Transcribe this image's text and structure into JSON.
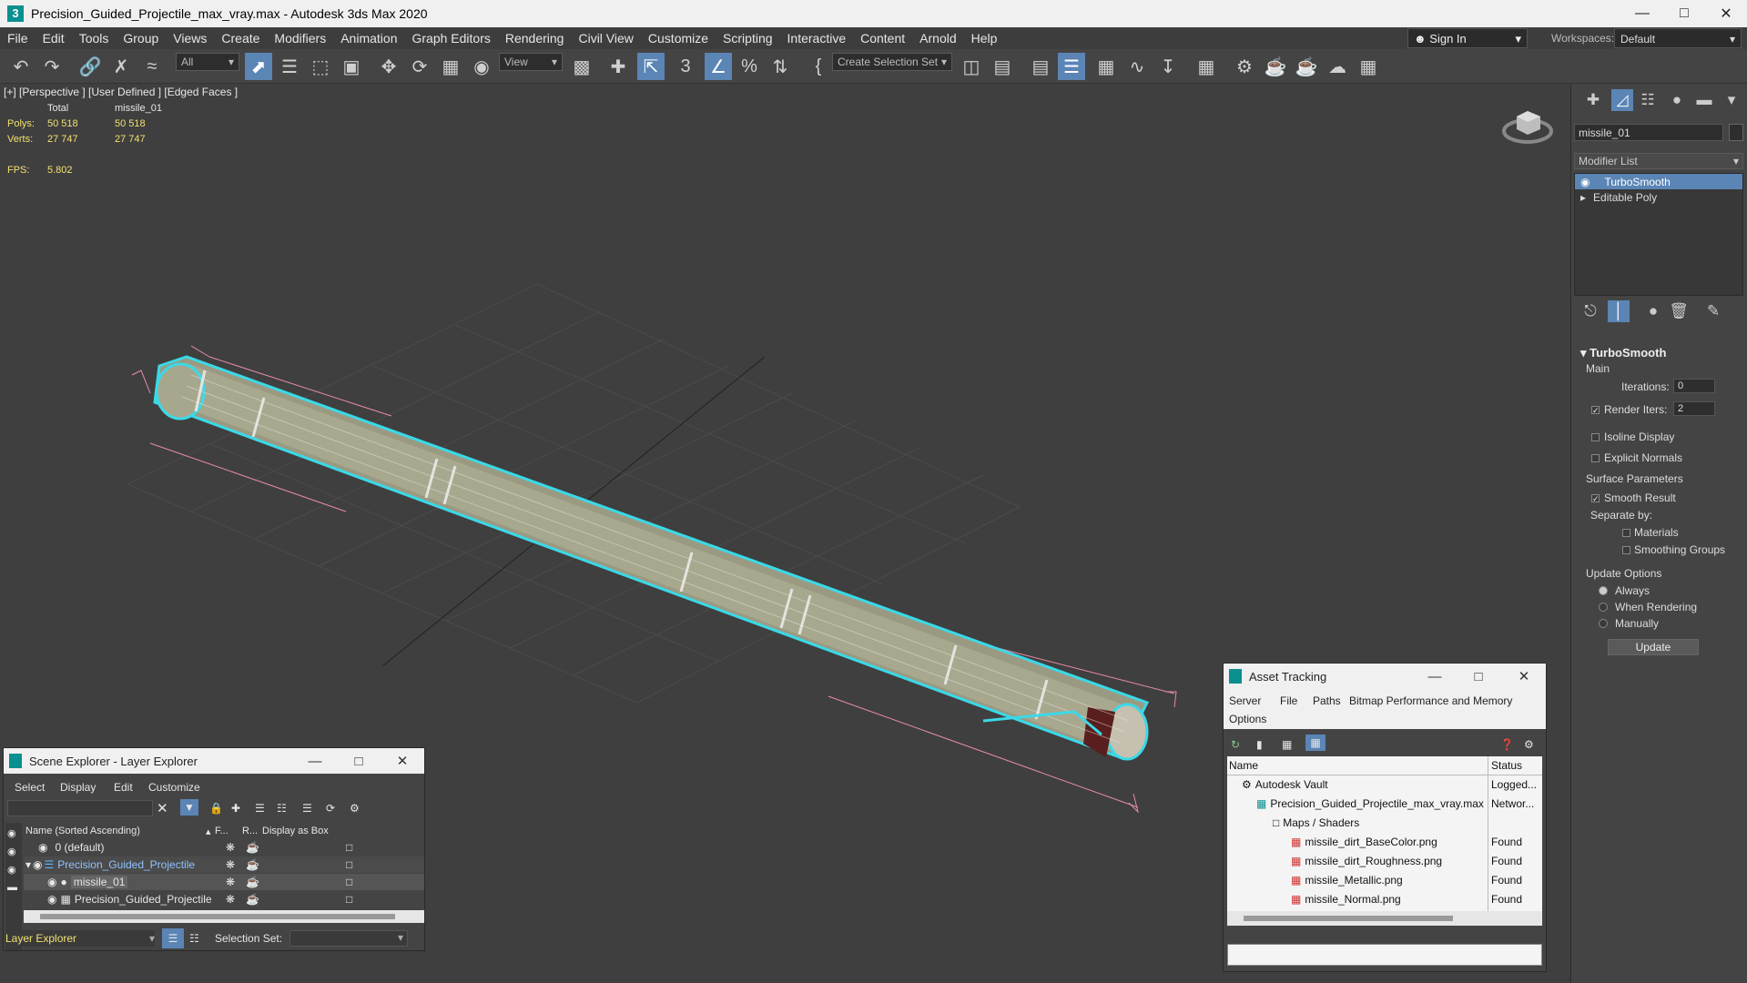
{
  "app": {
    "title": "Precision_Guided_Projectile_max_vray.max - Autodesk 3ds Max 2020"
  },
  "menu": [
    "File",
    "Edit",
    "Tools",
    "Group",
    "Views",
    "Create",
    "Modifiers",
    "Animation",
    "Graph Editors",
    "Rendering",
    "Civil View",
    "Customize",
    "Scripting",
    "Interactive",
    "Content",
    "Arnold",
    "Help"
  ],
  "account": {
    "sign_in": "Sign In",
    "workspaces_label": "Workspaces:",
    "workspace": "Default"
  },
  "toolbar": {
    "filter": "All",
    "ref_coord": "View",
    "selection_set": "Create Selection Set",
    "snap_label": "3"
  },
  "viewport": {
    "label": "[+] [Perspective ] [User Defined ] [Edged Faces ]",
    "stats": {
      "total_label": "Total",
      "object_label": "missile_01",
      "polys_label": "Polys:",
      "polys_total": "50 518",
      "polys_obj": "50 518",
      "verts_label": "Verts:",
      "verts_total": "27 747",
      "verts_obj": "27 747",
      "fps_label": "FPS:",
      "fps_value": "5.802"
    }
  },
  "command_panel": {
    "object_name": "missile_01",
    "modifier_list": "Modifier List",
    "stack": [
      "TurboSmooth",
      "Editable Poly"
    ],
    "turbosmooth": {
      "title": "TurboSmooth",
      "main": "Main",
      "iterations_label": "Iterations:",
      "iterations": "0",
      "render_iters_label": "Render Iters:",
      "render_iters": "2",
      "isoline": "Isoline Display",
      "explicit_normals": "Explicit Normals",
      "surface_params": "Surface Parameters",
      "smooth_result": "Smooth Result",
      "separate_by": "Separate by:",
      "materials": "Materials",
      "smoothing_groups": "Smoothing Groups",
      "update_options": "Update Options",
      "always": "Always",
      "when_rendering": "When Rendering",
      "manually": "Manually",
      "update": "Update"
    }
  },
  "scene_explorer": {
    "title": "Scene Explorer - Layer Explorer",
    "menu": [
      "Select",
      "Display",
      "Edit",
      "Customize"
    ],
    "columns": {
      "name": "Name (Sorted Ascending)",
      "f": "F...",
      "r": "R...",
      "box": "Display as Box"
    },
    "rows": [
      "0 (default)",
      "Precision_Guided_Projectile",
      "missile_01",
      "Precision_Guided_Projectile"
    ],
    "footer": {
      "explorer": "Layer Explorer",
      "selection_set": "Selection Set:"
    }
  },
  "asset_tracking": {
    "title": "Asset Tracking",
    "menu": [
      "Server",
      "File",
      "Paths",
      "Bitmap Performance and Memory",
      "Options"
    ],
    "columns": {
      "name": "Name",
      "status": "Status"
    },
    "rows": [
      {
        "name": "Autodesk Vault",
        "status": "Logged..."
      },
      {
        "name": "Precision_Guided_Projectile_max_vray.max",
        "status": "Networ..."
      },
      {
        "name": "Maps / Shaders",
        "status": ""
      },
      {
        "name": "missile_dirt_BaseColor.png",
        "status": "Found"
      },
      {
        "name": "missile_dirt_Roughness.png",
        "status": "Found"
      },
      {
        "name": "missile_Metallic.png",
        "status": "Found"
      },
      {
        "name": "missile_Normal.png",
        "status": "Found"
      }
    ]
  }
}
